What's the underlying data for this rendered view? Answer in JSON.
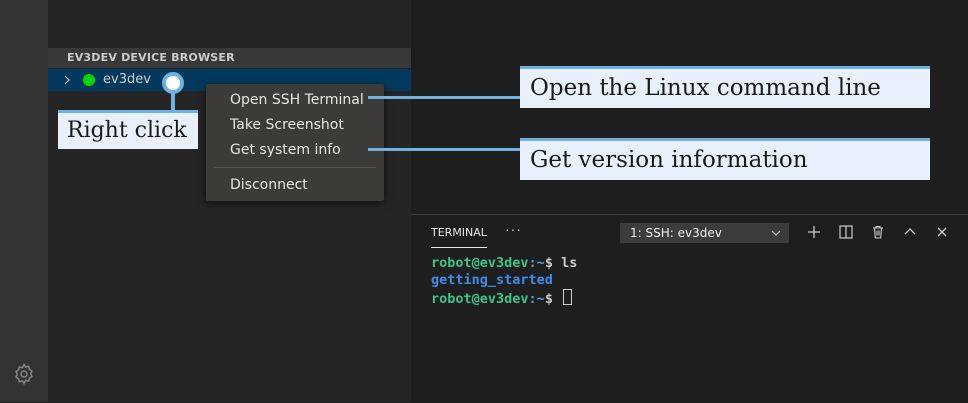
{
  "sidebar": {
    "section_title": "EV3DEV DEVICE BROWSER",
    "device": {
      "name": "ev3dev",
      "status_color": "#00d800"
    }
  },
  "context_menu": {
    "items": [
      {
        "label": "Open SSH Terminal"
      },
      {
        "label": "Take Screenshot"
      },
      {
        "label": "Get system info"
      },
      {
        "label": "Disconnect"
      }
    ]
  },
  "callouts": {
    "right_click": "Right click",
    "ssh_terminal": "Open the Linux command line",
    "system_info": "Get version information"
  },
  "panel": {
    "tab_label": "TERMINAL",
    "more_label": "···",
    "terminal_select": "1: SSH: ev3dev",
    "icons": [
      "plus-icon",
      "split-icon",
      "trash-icon",
      "chevron-up-icon",
      "close-icon"
    ]
  },
  "terminal": {
    "line1": {
      "user": "robot@ev3dev",
      "path": ":~",
      "prompt": "$ ",
      "command": "ls"
    },
    "line2": {
      "output": "getting_started"
    },
    "line3": {
      "user": "robot@ev3dev",
      "path": ":~",
      "prompt": "$ "
    }
  },
  "colors": {
    "accent": "#6fb1e1",
    "callout_bg": "#e8f1fb",
    "selection": "#04395e",
    "prompt_user": "#3ec48a",
    "directory": "#3b8eea"
  }
}
